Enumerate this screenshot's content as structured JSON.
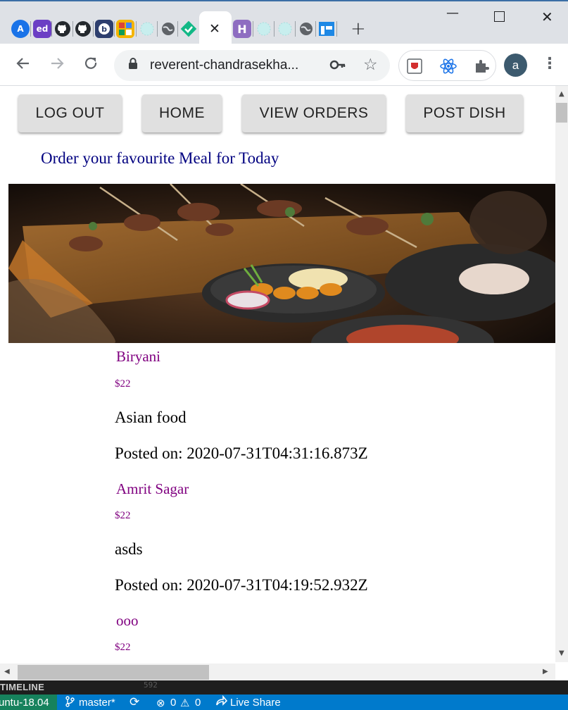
{
  "browser": {
    "url": "reverent-chandrasekha...",
    "avatar_letter": "a",
    "tab_favicons": [
      "A",
      "ed",
      "github",
      "github",
      "b",
      "grid",
      "loading",
      "globe",
      "check",
      "h",
      "loading",
      "loading",
      "globe",
      "table"
    ],
    "colors": {
      "tab_strip": "#dee1e6",
      "toolbar": "#ffffff",
      "avatar": "#3c5a6e"
    }
  },
  "nav": {
    "buttons": [
      "LOG OUT",
      "HOME",
      "VIEW ORDERS",
      "POST DISH"
    ]
  },
  "page": {
    "tagline": "Order your favourite Meal for Today"
  },
  "dishes": [
    {
      "name": "Biryani",
      "price": "$22",
      "description": "Asian food",
      "posted": "Posted on: 2020-07-31T04:31:16.873Z"
    },
    {
      "name": "Amrit Sagar",
      "price": "$22",
      "description": "asds",
      "posted": "Posted on: 2020-07-31T04:19:52.932Z"
    },
    {
      "name": "ooo",
      "price": "$22"
    }
  ],
  "vscode": {
    "timeline_label": "TIMELINE",
    "timeline_number": "592",
    "remote": "untu-18.04",
    "branch": "master*",
    "errors": "0",
    "warnings": "0",
    "live_share": "Live Share",
    "colors": {
      "status_bar": "#007acc",
      "remote": "#16825d"
    }
  }
}
